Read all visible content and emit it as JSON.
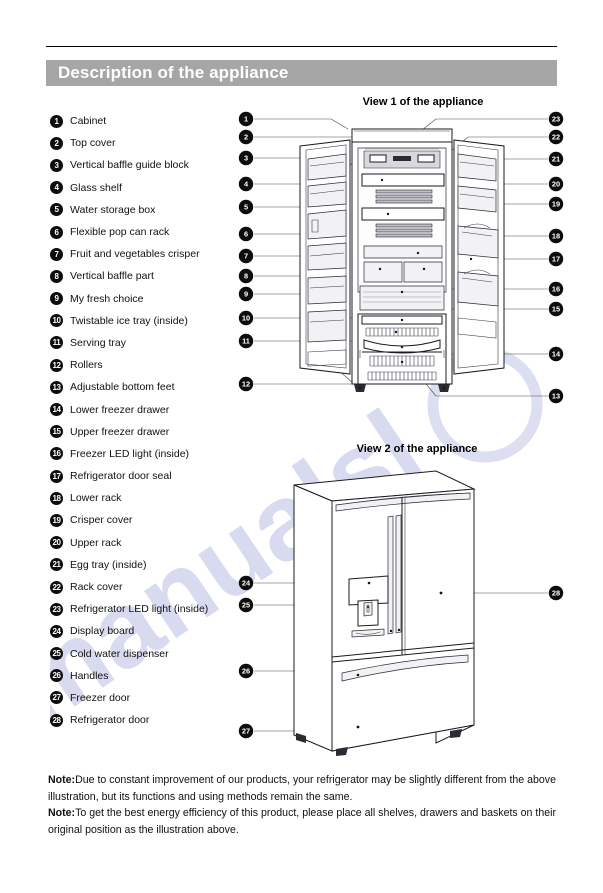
{
  "header": {
    "title": "Description of the appliance",
    "banner_color": "#a6a6a6"
  },
  "parts_list": [
    {
      "number": "1",
      "label": "Cabinet"
    },
    {
      "number": "2",
      "label": "Top cover"
    },
    {
      "number": "3",
      "label": "Vertical baffle guide block"
    },
    {
      "number": "4",
      "label": "Glass shelf"
    },
    {
      "number": "5",
      "label": "Water storage box"
    },
    {
      "number": "6",
      "label": "Flexible pop can rack"
    },
    {
      "number": "7",
      "label": "Fruit and vegetables crisper"
    },
    {
      "number": "8",
      "label": "Vertical baffle part"
    },
    {
      "number": "9",
      "label": "My fresh choice"
    },
    {
      "number": "10",
      "label": "Twistable ice tray (inside)"
    },
    {
      "number": "11",
      "label": "Serving tray"
    },
    {
      "number": "12",
      "label": "Rollers"
    },
    {
      "number": "13",
      "label": "Adjustable bottom feet"
    },
    {
      "number": "14",
      "label": "Lower freezer drawer"
    },
    {
      "number": "15",
      "label": "Upper freezer drawer"
    },
    {
      "number": "16",
      "label": "Freezer LED light (inside)"
    },
    {
      "number": "17",
      "label": "Refrigerator door seal"
    },
    {
      "number": "18",
      "label": "Lower rack"
    },
    {
      "number": "19",
      "label": "Crisper cover"
    },
    {
      "number": "20",
      "label": "Upper rack"
    },
    {
      "number": "21",
      "label": "Egg tray (inside)"
    },
    {
      "number": "22",
      "label": "Rack cover"
    },
    {
      "number": "23",
      "label": "Refrigerator LED light (inside)"
    },
    {
      "number": "24",
      "label": "Display board"
    },
    {
      "number": "25",
      "label": "Cold water dispenser"
    },
    {
      "number": "26",
      "label": "Handles"
    },
    {
      "number": "27",
      "label": "Freezer door"
    },
    {
      "number": "28",
      "label": "Refrigerator door"
    }
  ],
  "view1": {
    "title": "View 1 of the appliance",
    "callouts_left": [
      "1",
      "2",
      "3",
      "4",
      "5",
      "6",
      "7",
      "8",
      "9",
      "10",
      "11",
      "12"
    ],
    "callouts_right": [
      "23",
      "22",
      "21",
      "20",
      "19",
      "18",
      "17",
      "16",
      "15",
      "14",
      "13"
    ]
  },
  "view2": {
    "title": "View 2 of the appliance",
    "callouts_left": [
      "24",
      "25",
      "26",
      "27"
    ],
    "callouts_right": [
      "28"
    ]
  },
  "notes": [
    {
      "label": "Note:",
      "text": "Due to constant improvement of our products, your refrigerator may be slightly different from the above illustration, but its functions and using methods remain the same."
    },
    {
      "label": "Note:",
      "text": "To get the best energy efficiency of this product, please place all shelves, drawers and baskets on their original position as the illustration above."
    }
  ],
  "watermark": {
    "text": "manualsl",
    "color": "#b9bde4"
  }
}
